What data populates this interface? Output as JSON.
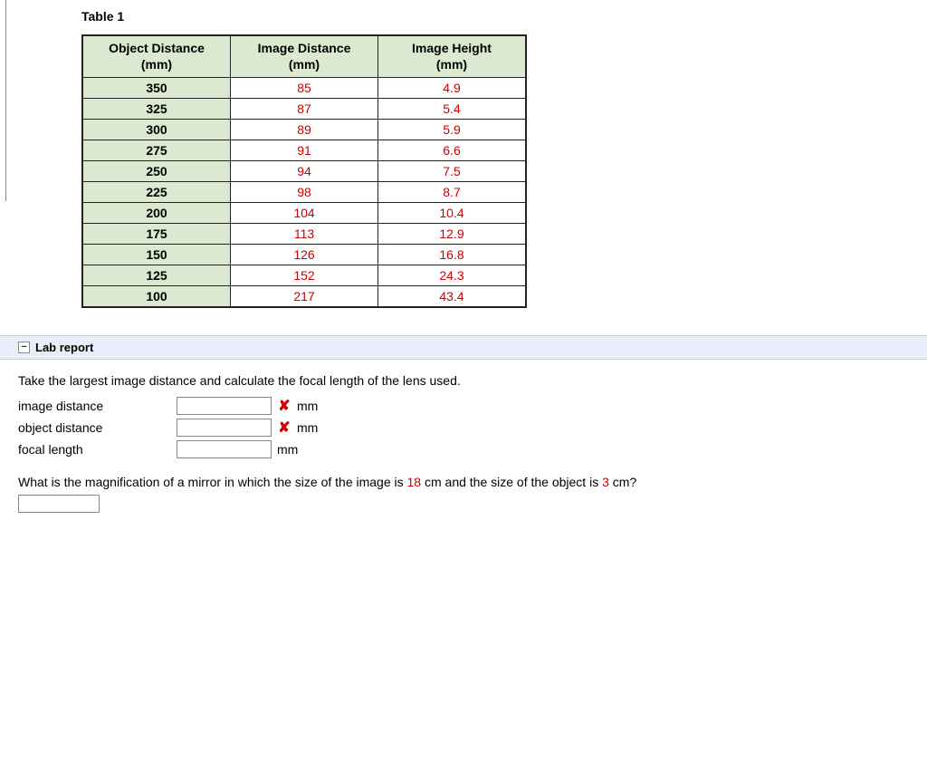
{
  "table": {
    "title": "Table 1",
    "headers": {
      "object": {
        "line1": "Object Distance",
        "line2": "(mm)"
      },
      "image": {
        "line1": "Image Distance",
        "line2": "(mm)"
      },
      "height": {
        "line1": "Image Height",
        "line2": "(mm)"
      }
    },
    "rows": [
      {
        "obj": "350",
        "img": "85",
        "hgt": "4.9"
      },
      {
        "obj": "325",
        "img": "87",
        "hgt": "5.4"
      },
      {
        "obj": "300",
        "img": "89",
        "hgt": "5.9"
      },
      {
        "obj": "275",
        "img": "91",
        "hgt": "6.6"
      },
      {
        "obj": "250",
        "img": "94",
        "hgt": "7.5"
      },
      {
        "obj": "225",
        "img": "98",
        "hgt": "8.7"
      },
      {
        "obj": "200",
        "img": "104",
        "hgt": "10.4"
      },
      {
        "obj": "175",
        "img": "113",
        "hgt": "12.9"
      },
      {
        "obj": "150",
        "img": "126",
        "hgt": "16.8"
      },
      {
        "obj": "125",
        "img": "152",
        "hgt": "24.3"
      },
      {
        "obj": "100",
        "img": "217",
        "hgt": "43.4"
      }
    ]
  },
  "section": {
    "title": "Lab report",
    "collapse_glyph": "−"
  },
  "lab": {
    "instruction": "Take the largest image distance and calculate the focal length of the lens used.",
    "fields": {
      "image_distance": {
        "label": "image distance",
        "value": "",
        "unit": "mm",
        "wrong": true
      },
      "object_distance": {
        "label": "object distance",
        "value": "",
        "unit": "mm",
        "wrong": true
      },
      "focal_length": {
        "label": "focal length",
        "value": "",
        "unit": "mm",
        "wrong": false
      }
    },
    "wrong_glyph": "✘",
    "q2": {
      "pre": "What is the magnification of a mirror in which the size of the image is ",
      "v1": "18",
      "mid": " cm and the size of the object is ",
      "v2": "3",
      "post": " cm?",
      "value": ""
    }
  }
}
